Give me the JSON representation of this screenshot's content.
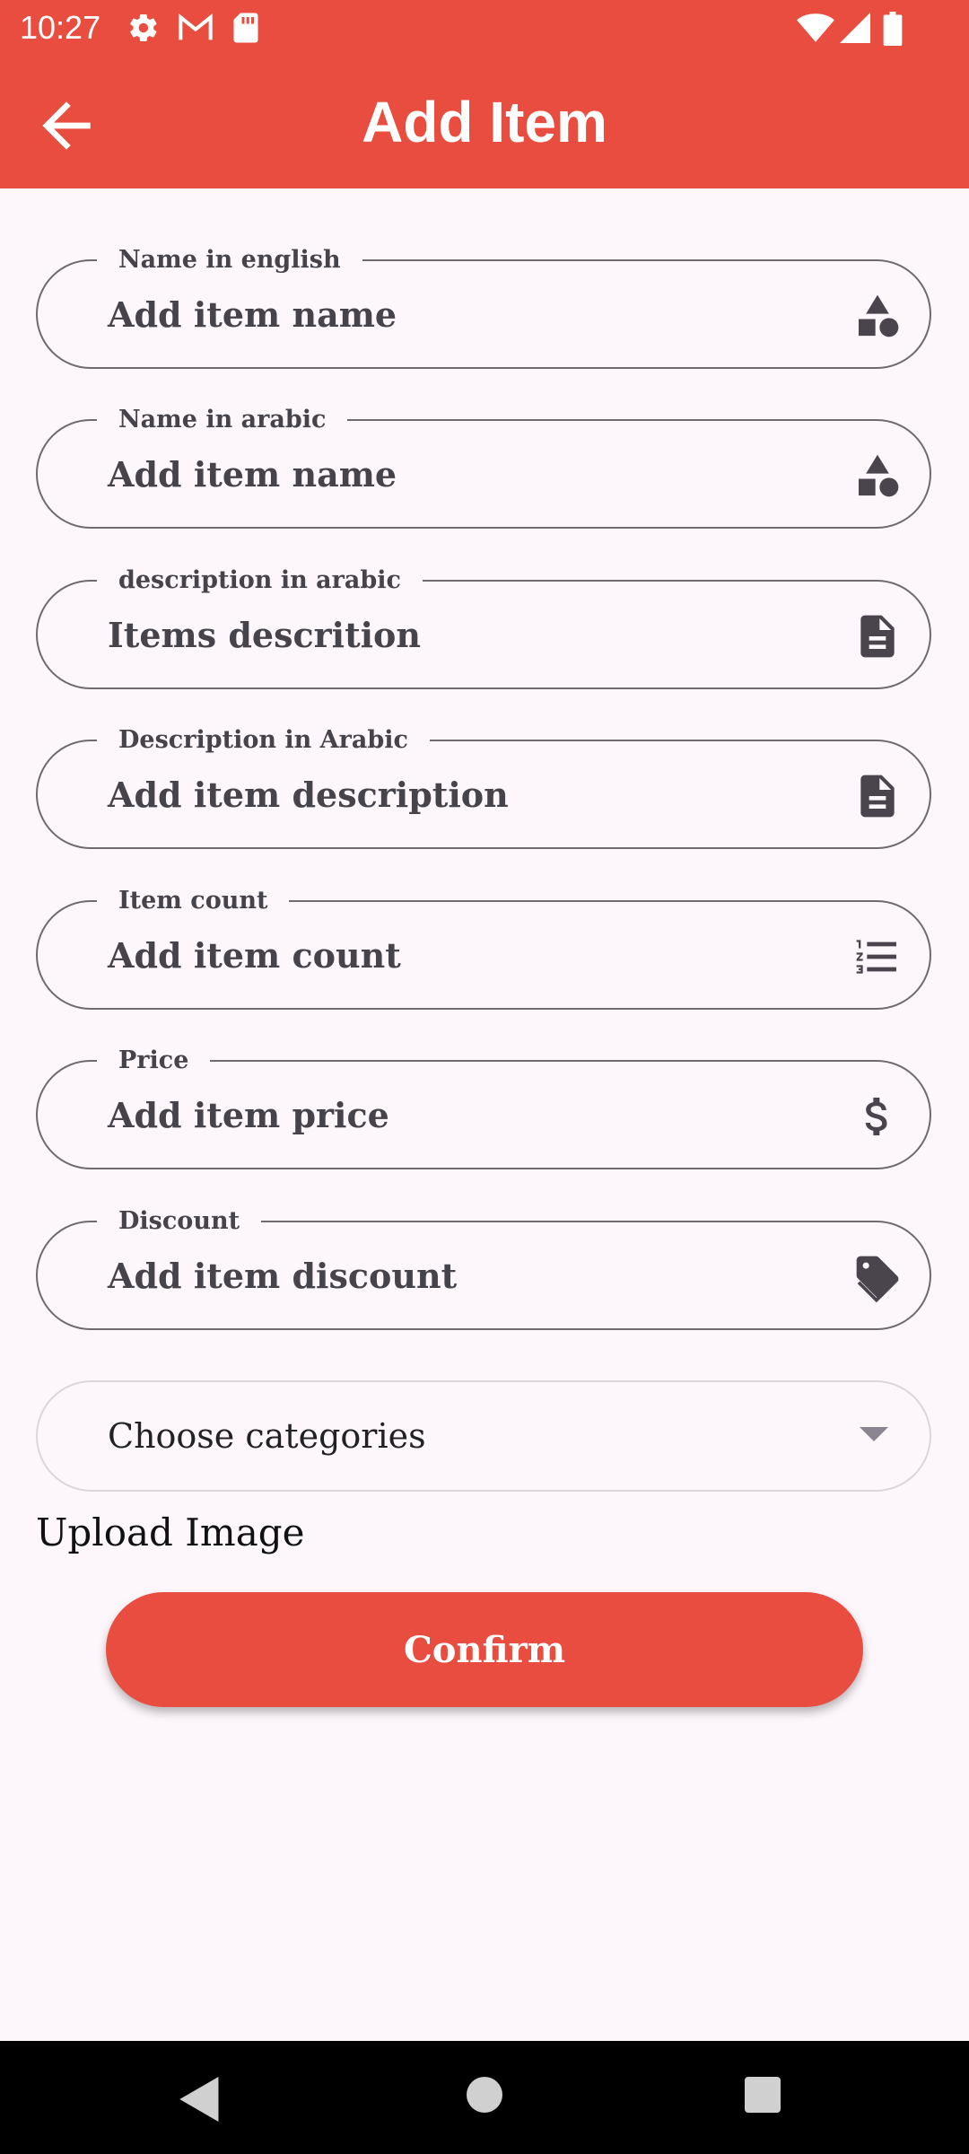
{
  "status_bar": {
    "time": "10:27"
  },
  "app_bar": {
    "title": "Add Item"
  },
  "fields": [
    {
      "label": "Name in english",
      "value": "Add item name",
      "icon": "category-shapes-icon"
    },
    {
      "label": "Name in arabic",
      "value": "Add item name",
      "icon": "category-shapes-icon"
    },
    {
      "label": "description in arabic",
      "value": "Items descrition",
      "icon": "document-icon"
    },
    {
      "label": "Description in Arabic",
      "value": "Add item description",
      "icon": "document-icon"
    },
    {
      "label": "Item count",
      "value": "Add item count",
      "icon": "numbered-list-icon"
    },
    {
      "label": "Price",
      "value": "Add item price",
      "icon": "dollar-icon"
    },
    {
      "label": "Discount",
      "value": "Add item discount",
      "icon": "tag-icon"
    }
  ],
  "category_select": {
    "selected": "Choose categories"
  },
  "upload": {
    "label": "Upload Image"
  },
  "confirm": {
    "label": "Confirm"
  },
  "colors": {
    "primary": "#E84D3F",
    "background": "#FDF7FC",
    "outline": "#6F6A70"
  }
}
